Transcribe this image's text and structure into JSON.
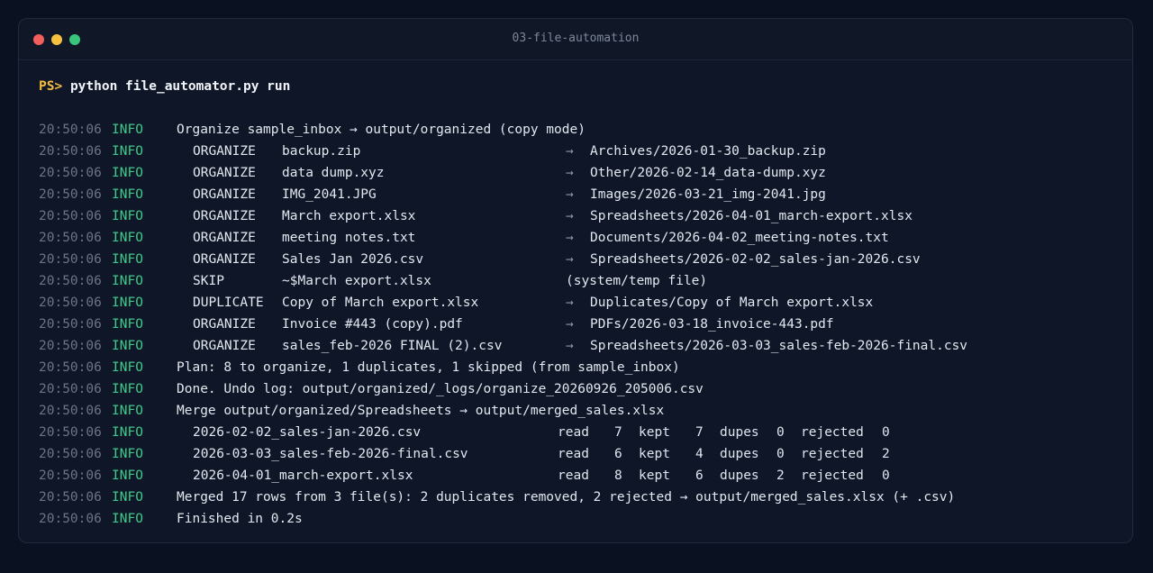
{
  "window": {
    "title": "03-file-automation"
  },
  "prompt": {
    "ps": "PS>",
    "command": "python file_automator.py run"
  },
  "log": {
    "header": {
      "ts": "20:50:06",
      "level": "INFO",
      "message": "Organize sample_inbox → output/organized (copy mode)"
    },
    "organize_rows": [
      {
        "ts": "20:50:06",
        "level": "INFO",
        "action": "ORGANIZE",
        "file": "backup.zip",
        "arrow": "→",
        "dest": "Archives/2026-01-30_backup.zip"
      },
      {
        "ts": "20:50:06",
        "level": "INFO",
        "action": "ORGANIZE",
        "file": "data dump.xyz",
        "arrow": "→",
        "dest": "Other/2026-02-14_data-dump.xyz"
      },
      {
        "ts": "20:50:06",
        "level": "INFO",
        "action": "ORGANIZE",
        "file": "IMG_2041.JPG",
        "arrow": "→",
        "dest": "Images/2026-03-21_img-2041.jpg"
      },
      {
        "ts": "20:50:06",
        "level": "INFO",
        "action": "ORGANIZE",
        "file": "March export.xlsx",
        "arrow": "→",
        "dest": "Spreadsheets/2026-04-01_march-export.xlsx"
      },
      {
        "ts": "20:50:06",
        "level": "INFO",
        "action": "ORGANIZE",
        "file": "meeting notes.txt",
        "arrow": "→",
        "dest": "Documents/2026-04-02_meeting-notes.txt"
      },
      {
        "ts": "20:50:06",
        "level": "INFO",
        "action": "ORGANIZE",
        "file": "Sales Jan 2026.csv",
        "arrow": "→",
        "dest": "Spreadsheets/2026-02-02_sales-jan-2026.csv"
      },
      {
        "ts": "20:50:06",
        "level": "INFO",
        "action": "SKIP",
        "file": "~$March export.xlsx",
        "note": "(system/temp file)"
      },
      {
        "ts": "20:50:06",
        "level": "INFO",
        "action": "DUPLICATE",
        "file": "Copy of March export.xlsx",
        "arrow": "→",
        "dest": "Duplicates/Copy of March export.xlsx"
      },
      {
        "ts": "20:50:06",
        "level": "INFO",
        "action": "ORGANIZE",
        "file": "Invoice #443 (copy).pdf",
        "arrow": "→",
        "dest": "PDFs/2026-03-18_invoice-443.pdf"
      },
      {
        "ts": "20:50:06",
        "level": "INFO",
        "action": "ORGANIZE",
        "file": "sales_feb-2026 FINAL (2).csv",
        "arrow": "→",
        "dest": "Spreadsheets/2026-03-03_sales-feb-2026-final.csv"
      }
    ],
    "plan": {
      "ts": "20:50:06",
      "level": "INFO",
      "message": "Plan: 8 to organize, 1 duplicates, 1 skipped (from sample_inbox)"
    },
    "done": {
      "ts": "20:50:06",
      "level": "INFO",
      "message": "Done. Undo log: output/organized/_logs/organize_20260926_205006.csv"
    },
    "merge": {
      "ts": "20:50:06",
      "level": "INFO",
      "message": "Merge output/organized/Spreadsheets → output/merged_sales.xlsx"
    },
    "merge_rows": [
      {
        "ts": "20:50:06",
        "level": "INFO",
        "file": "2026-02-02_sales-jan-2026.csv",
        "read_label": "read",
        "read": "7",
        "kept_label": "kept",
        "kept": "7",
        "dupes_label": "dupes",
        "dupes": "0",
        "rejected_label": "rejected",
        "rejected": "0"
      },
      {
        "ts": "20:50:06",
        "level": "INFO",
        "file": "2026-03-03_sales-feb-2026-final.csv",
        "read_label": "read",
        "read": "6",
        "kept_label": "kept",
        "kept": "4",
        "dupes_label": "dupes",
        "dupes": "0",
        "rejected_label": "rejected",
        "rejected": "2"
      },
      {
        "ts": "20:50:06",
        "level": "INFO",
        "file": "2026-04-01_march-export.xlsx",
        "read_label": "read",
        "read": "8",
        "kept_label": "kept",
        "kept": "6",
        "dupes_label": "dupes",
        "dupes": "2",
        "rejected_label": "rejected",
        "rejected": "0"
      }
    ],
    "merged": {
      "ts": "20:50:06",
      "level": "INFO",
      "message": "Merged 17 rows from 3 file(s): 2 duplicates removed, 2 rejected → output/merged_sales.xlsx (+ .csv)"
    },
    "finished": {
      "ts": "20:50:06",
      "level": "INFO",
      "message": "Finished in 0.2s"
    }
  }
}
